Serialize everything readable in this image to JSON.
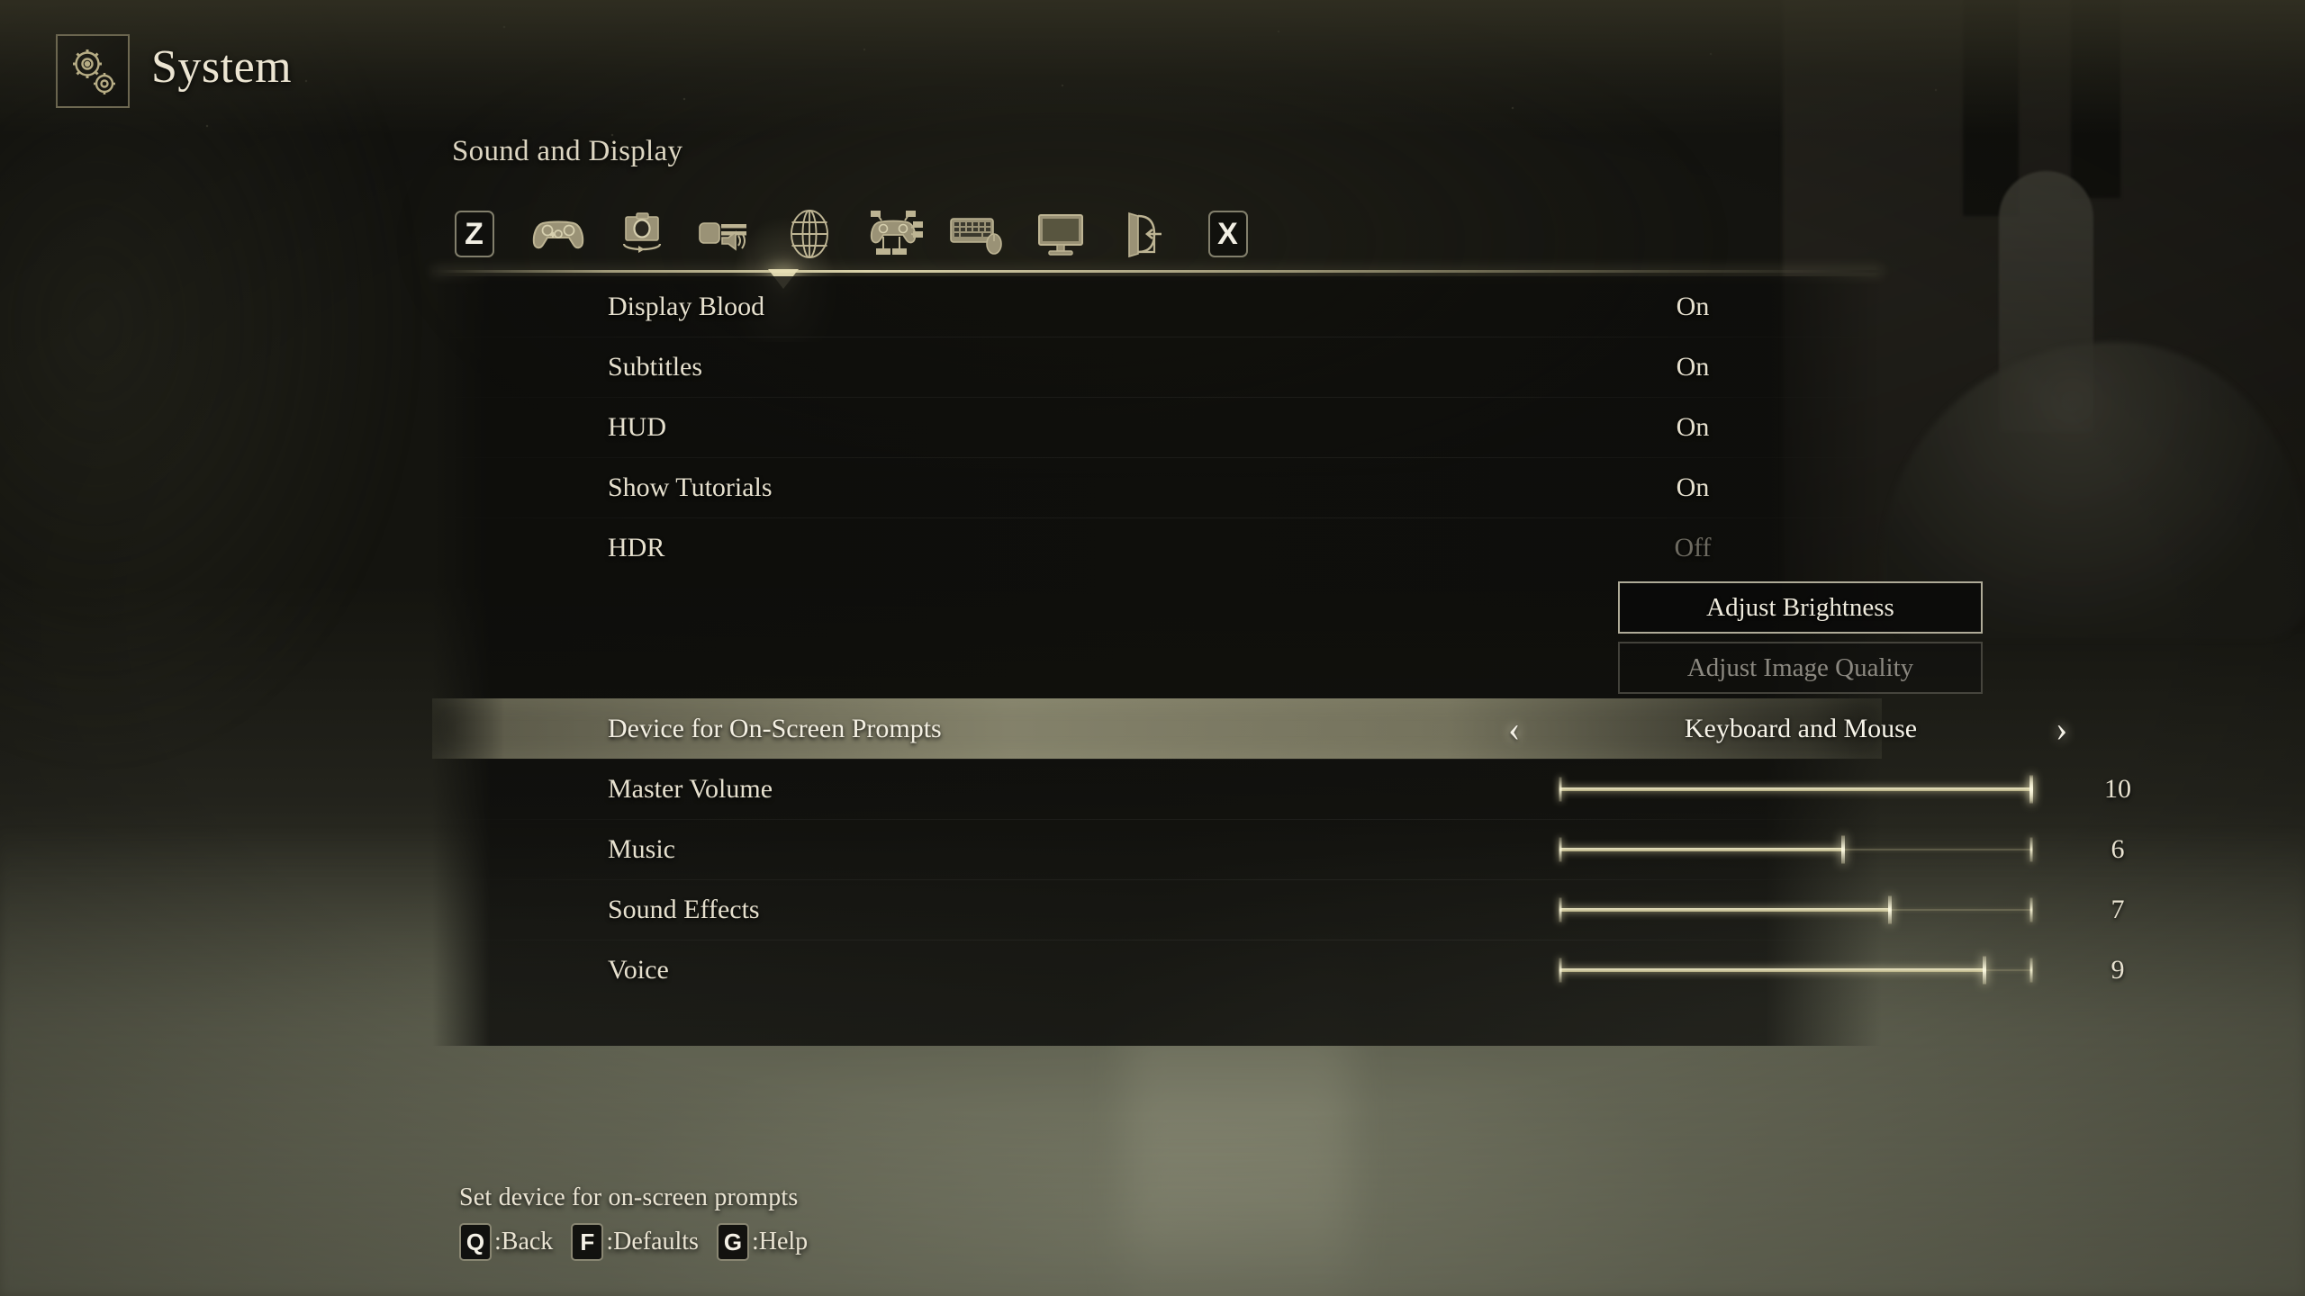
{
  "header": {
    "title": "System",
    "icon": "gears-icon"
  },
  "subtitle": "Sound and Display",
  "tabs": [
    {
      "icon": "key-z",
      "label": "Z",
      "selected": false,
      "type": "keycap"
    },
    {
      "icon": "gamepad-icon",
      "label": "Controller",
      "selected": false,
      "type": "icon"
    },
    {
      "icon": "camera-rotate-icon",
      "label": "Camera",
      "selected": false,
      "type": "icon"
    },
    {
      "icon": "sound-display-icon",
      "label": "Sound and Display",
      "selected": true,
      "type": "icon"
    },
    {
      "icon": "globe-icon",
      "label": "Network",
      "selected": false,
      "type": "icon"
    },
    {
      "icon": "gamepad-config-icon",
      "label": "Controller Settings",
      "selected": false,
      "type": "icon"
    },
    {
      "icon": "keyboard-mouse-icon",
      "label": "Keyboard and Mouse",
      "selected": false,
      "type": "icon"
    },
    {
      "icon": "monitor-icon",
      "label": "Graphics",
      "selected": false,
      "type": "icon"
    },
    {
      "icon": "exit-door-icon",
      "label": "Exit Game",
      "selected": false,
      "type": "icon"
    },
    {
      "icon": "key-x",
      "label": "X",
      "selected": false,
      "type": "keycap"
    }
  ],
  "settings": [
    {
      "kind": "toggle",
      "label": "Display Blood",
      "value": "On",
      "disabled": false
    },
    {
      "kind": "toggle",
      "label": "Subtitles",
      "value": "On",
      "disabled": false
    },
    {
      "kind": "toggle",
      "label": "HUD",
      "value": "On",
      "disabled": false
    },
    {
      "kind": "toggle",
      "label": "Show Tutorials",
      "value": "On",
      "disabled": false
    },
    {
      "kind": "toggle",
      "label": "HDR",
      "value": "Off",
      "disabled": true
    },
    {
      "kind": "button",
      "label": "Adjust Brightness",
      "disabled": false
    },
    {
      "kind": "button",
      "label": "Adjust Image Quality",
      "disabled": true
    },
    {
      "kind": "selector",
      "label": "Device for On-Screen Prompts",
      "value": "Keyboard and Mouse",
      "selected": true,
      "left_arrow": "‹",
      "right_arrow": "›"
    },
    {
      "kind": "slider",
      "label": "Master Volume",
      "value": "10",
      "percent": 100
    },
    {
      "kind": "slider",
      "label": "Music",
      "value": "6",
      "percent": 60
    },
    {
      "kind": "slider",
      "label": "Sound Effects",
      "value": "7",
      "percent": 70
    },
    {
      "kind": "slider",
      "label": "Voice",
      "value": "9",
      "percent": 90
    }
  ],
  "footer": {
    "description": "Set device for on-screen prompts",
    "hints": [
      {
        "key": "Q",
        "label": ":Back"
      },
      {
        "key": "F",
        "label": ":Defaults"
      },
      {
        "key": "G",
        "label": ":Help"
      }
    ]
  },
  "colors": {
    "accent": "#e8e0b6",
    "text": "#e6e0ce",
    "dim_text": "#6d6a60",
    "highlight_row": "#b0ad8e",
    "panel_bg": "#0e0e0b"
  }
}
